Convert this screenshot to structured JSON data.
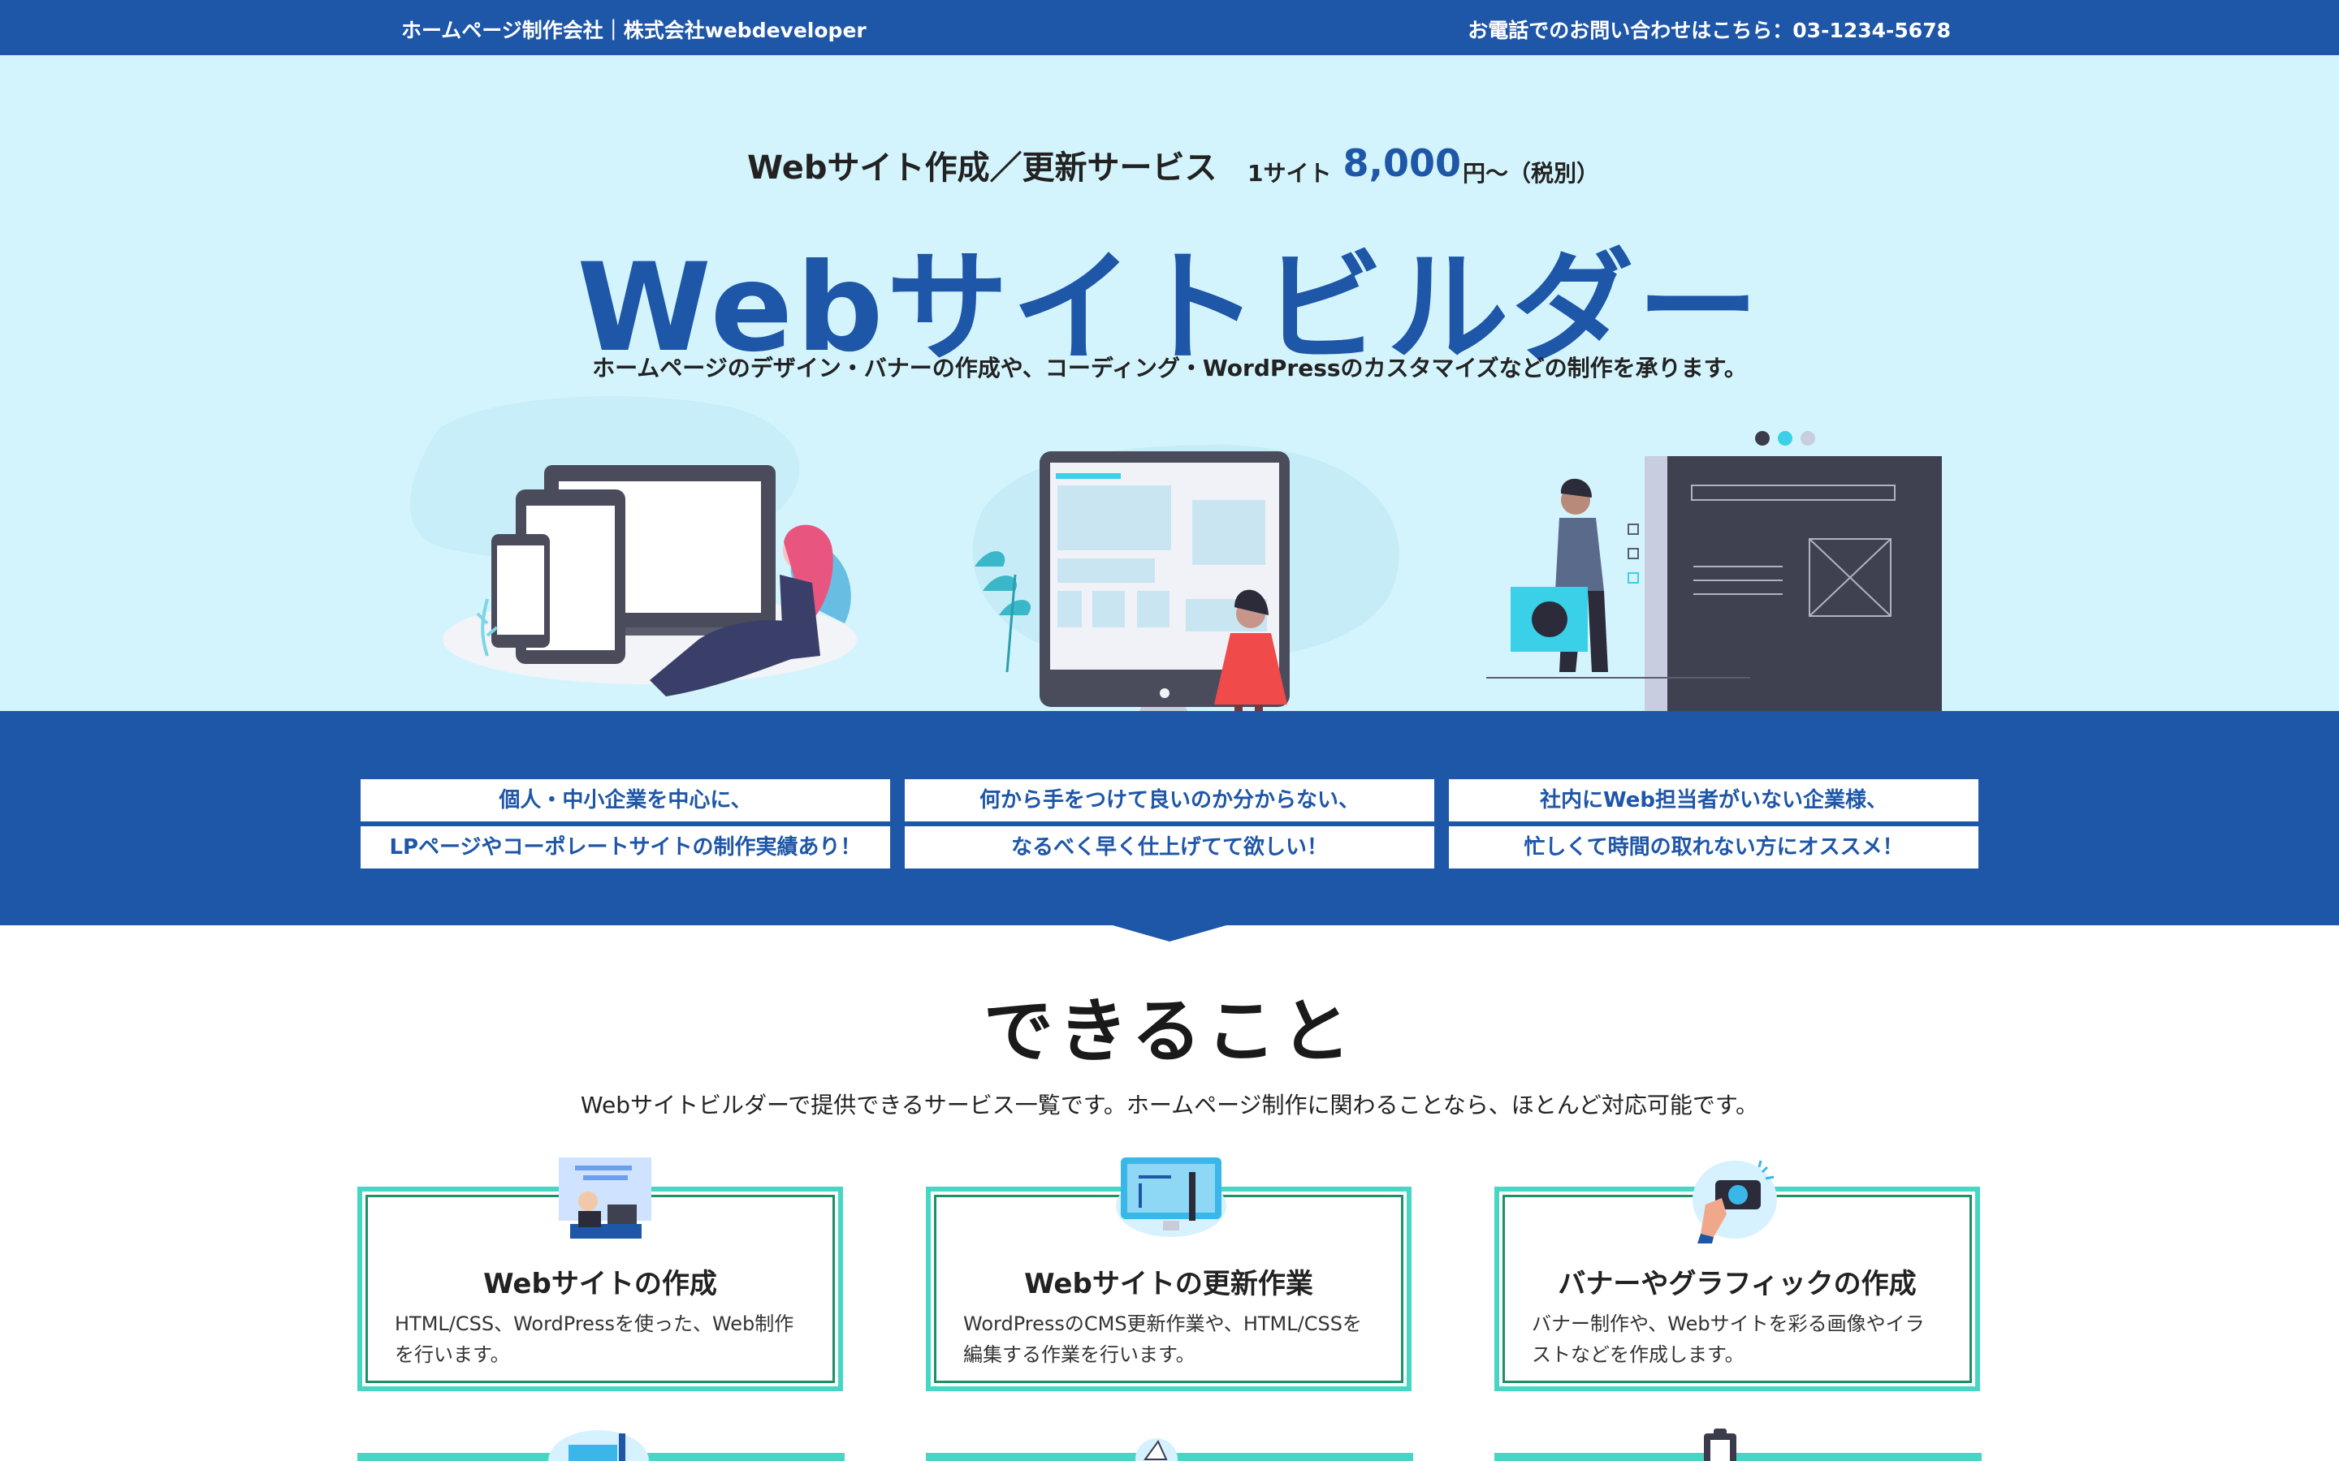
{
  "topbar": {
    "left": "ホームページ制作会社｜株式会社webdeveloper",
    "right": "お電話でのお問い合わせはこちら：03-1234-5678"
  },
  "hero": {
    "service": "Webサイト作成／更新サービス",
    "price_prefix": "1サイト",
    "price_amount": "8,000",
    "price_suffix": "円〜（税別）",
    "title": "Webサイトビルダー",
    "subtitle": "ホームページのデザイン・バナーの作成や、コーディング・WordPressのカスタマイズなどの制作を承ります。"
  },
  "features": [
    {
      "line1": "個人・中小企業を中心に、",
      "line2": "LPページやコーポレートサイトの制作実績あり！"
    },
    {
      "line1": "何から手をつけて良いのか分からない、",
      "line2": "なるべく早く仕上げてて欲しい！"
    },
    {
      "line1": "社内にWeb担当者がいない企業様、",
      "line2": "忙しくて時間の取れない方にオススメ！"
    }
  ],
  "section": {
    "title": "できること",
    "description": "Webサイトビルダーで提供できるサービス一覧です。ホームページ制作に関わることなら、ほとんど対応可能です。"
  },
  "cards": [
    {
      "title": "Webサイトの作成",
      "description": "HTML/CSS、WordPressを使った、Web制作を行います。",
      "icon": "web-creation-icon"
    },
    {
      "title": "Webサイトの更新作業",
      "description": "WordPressのCMS更新作業や、HTML/CSSを編集する作業を行います。",
      "icon": "site-update-icon"
    },
    {
      "title": "バナーやグラフィックの作成",
      "description": "バナー制作や、Webサイトを彩る画像やイラストなどを作成します。",
      "icon": "camera-icon"
    }
  ],
  "colors": {
    "brand_blue": "#1e56a8",
    "hero_bg": "#d4f4fd",
    "card_border": "#47d6c4",
    "card_inner": "#1e8f66"
  }
}
